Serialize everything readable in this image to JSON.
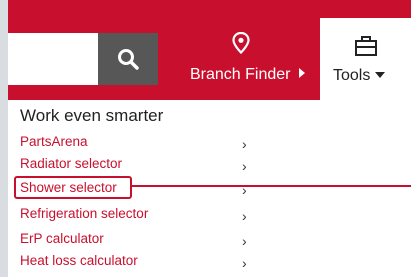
{
  "header": {
    "search": {
      "icon": "search-icon"
    },
    "branch_finder": {
      "label": "Branch Finder",
      "icon": "map-pin-icon"
    },
    "tools": {
      "label": "Tools",
      "icon": "toolbox-icon"
    }
  },
  "menu": {
    "title": "Work even smarter",
    "items": [
      {
        "label": "PartsArena"
      },
      {
        "label": "Radiator selector"
      },
      {
        "label": "Shower selector"
      },
      {
        "label": "Refrigeration selector"
      },
      {
        "label": "ErP calculator"
      },
      {
        "label": "Heat loss calculator"
      }
    ],
    "chevron": "›"
  },
  "colors": {
    "brand_red": "#c8102e",
    "search_button": "#575757",
    "link": "#c8102e"
  }
}
